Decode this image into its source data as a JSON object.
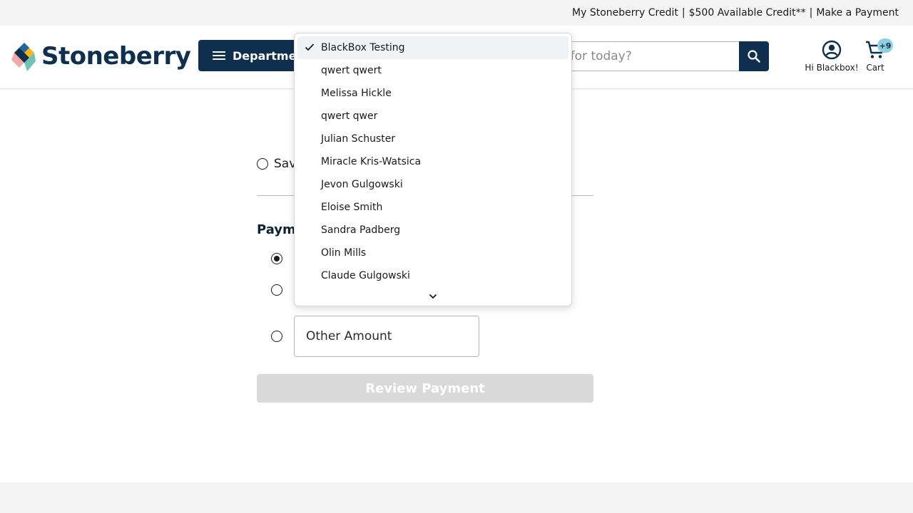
{
  "utility_bar": {
    "credit_link": "My Stoneberry Credit",
    "sep1": "|",
    "available_credit": "$500 Available Credit**",
    "sep2": "|",
    "payment_link": "Make a Payment"
  },
  "header": {
    "logo_text": "Stoneberry",
    "departments_label": "Departments",
    "search_placeholder": "What are you looking for today?",
    "account_label": "Hi Blackbox!",
    "cart_label": "Cart",
    "cart_badge": "+9"
  },
  "form": {
    "save_label": "Save",
    "section_title": "Payment",
    "other_amount_placeholder": "Other Amount",
    "review_button": "Review Payment"
  },
  "dropdown": {
    "selected_index": 0,
    "items": [
      "BlackBox Testing",
      "qwert qwert",
      "Melissa Hickle",
      "qwert qwer",
      "Julian Schuster",
      "Miracle Kris-Watsica",
      "Jevon Gulgowski",
      "Eloise Smith",
      "Sandra Padberg",
      "Olin Mills",
      "Claude Gulgowski"
    ]
  },
  "colors": {
    "brand_navy": "#0e2f4e",
    "badge": "#8fcfe0",
    "disabled_button": "#d9d9d9"
  },
  "icons": [
    "hamburger-icon",
    "search-icon",
    "account-icon",
    "cart-icon",
    "check-icon",
    "chevron-down-icon"
  ]
}
